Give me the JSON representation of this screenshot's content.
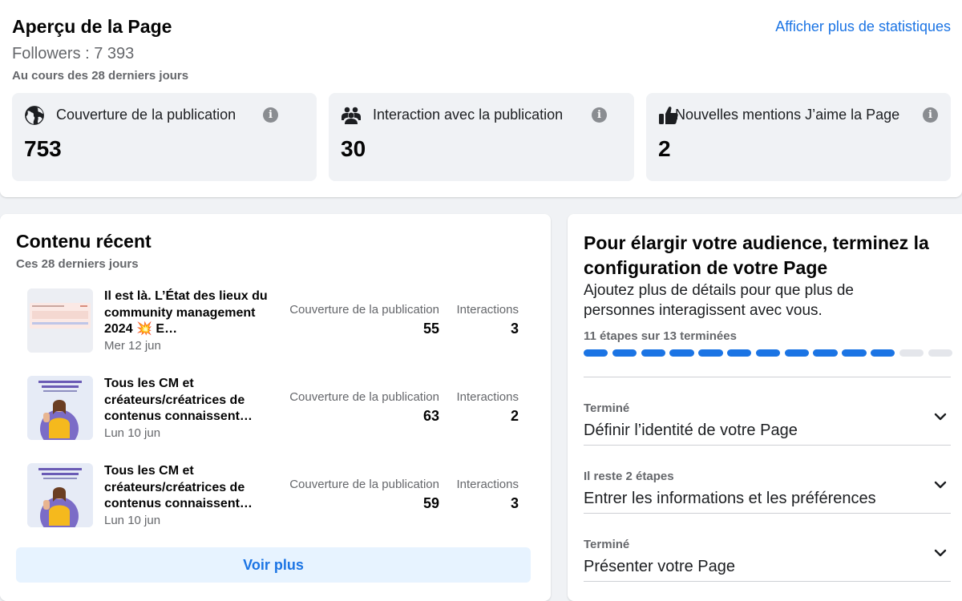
{
  "overview": {
    "title": "Aperçu de la Page",
    "followers": "Followers : 7 393",
    "period": "Au cours des 28 derniers jours",
    "more_link": "Afficher plus de statistiques",
    "stats": [
      {
        "label": "Couverture de la publication",
        "value": "753",
        "icon": "globe-icon"
      },
      {
        "label": "Interaction avec la publication",
        "value": "30",
        "icon": "people-icon"
      },
      {
        "label": "Nouvelles mentions J’aime la Page",
        "value": "2",
        "icon": "thumbs-up-icon"
      }
    ],
    "info_glyph": "i"
  },
  "recent": {
    "title": "Contenu récent",
    "subtitle": "Ces 28 derniers jours",
    "posts": [
      {
        "title": "Il est là. L’État des lieux du community management 2024 💥 E…",
        "date": "Mer 12 jun",
        "reach_label": "Couverture de la publication",
        "reach": "55",
        "interactions_label": "Interactions",
        "interactions": "3"
      },
      {
        "title": "Tous les CM et créateurs/créatrices de contenus connaissent…",
        "date": "Lun 10 jun",
        "reach_label": "Couverture de la publication",
        "reach": "63",
        "interactions_label": "Interactions",
        "interactions": "2"
      },
      {
        "title": "Tous les CM et créateurs/créatrices de contenus connaissent…",
        "date": "Lun 10 jun",
        "reach_label": "Couverture de la publication",
        "reach": "59",
        "interactions_label": "Interactions",
        "interactions": "3"
      }
    ],
    "see_more": "Voir plus"
  },
  "setup": {
    "title": "Pour élargir votre audience, terminez la configuration de votre Page",
    "description": "Ajoutez plus de détails pour que plus de personnes interagissent avec vous.",
    "progress_label": "11 étapes sur 13 terminées",
    "steps_done": 11,
    "steps_total": 13,
    "steps": [
      {
        "status": "Terminé",
        "name": "Définir l’identité de votre Page"
      },
      {
        "status": "Il reste 2 étapes",
        "name": "Entrer les informations et les préférences"
      },
      {
        "status": "Terminé",
        "name": "Présenter votre Page"
      }
    ]
  },
  "colors": {
    "accent": "#1b74e4",
    "progress_done": "#1b74e4",
    "progress_todo": "#e4e6eb"
  }
}
